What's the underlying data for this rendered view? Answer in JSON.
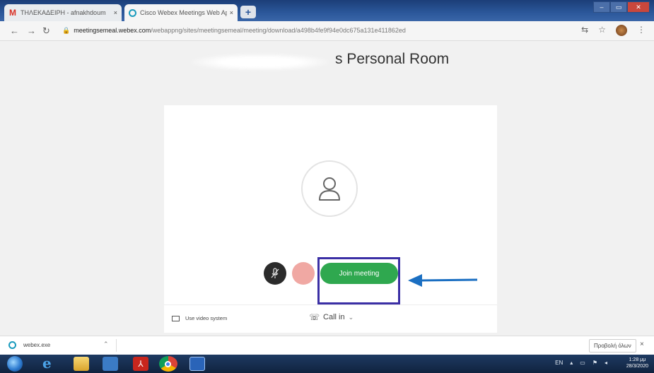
{
  "browser": {
    "tabs": [
      {
        "label": "ΤΗΛΕΚΑΔΕΙΡΗ - afnakhdoum",
        "favicon": "gmail-icon"
      },
      {
        "label": "Cisco Webex Meetings Web App",
        "favicon": "webex-icon"
      }
    ],
    "tab_close": "×",
    "new_tab": "+",
    "address": {
      "host": "meetingsemeal.webex.com",
      "path": "/webappng/sites/meetingsemeal/meeting/download/a498b4fe9f94e0dc675a131e411862ed"
    }
  },
  "page": {
    "room_title": "s Personal Room",
    "join_button": "Join meeting",
    "video_system": "Use video system",
    "call_in": "Call in",
    "highlight_color": "#3b2fa5",
    "arrow_color": "#1b6fc2",
    "join_color": "#2fa84f"
  },
  "downloads": {
    "file": "webex.exe",
    "show_all": "Προβολή όλων",
    "close": "×"
  },
  "taskbar": {
    "language": "EN",
    "time": "1:28 μμ",
    "date": "28/3/2020"
  }
}
